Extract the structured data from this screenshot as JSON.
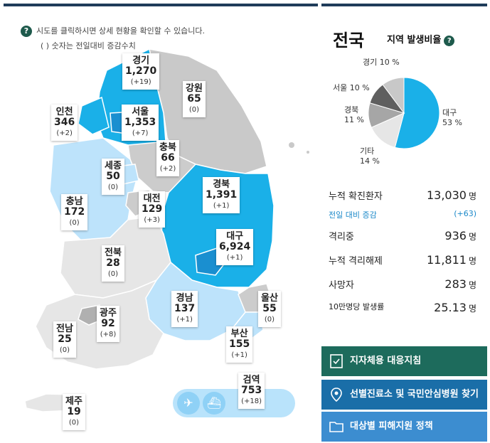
{
  "info": {
    "line1": "시도를 클릭하시면 상세 현황을 확인할 수 있습니다.",
    "line2": "( ) 숫자는 전일대비 증감수치",
    "icon": "question-icon"
  },
  "regions": [
    {
      "key": "gyeonggi",
      "name": "경기",
      "value": "1,270",
      "delta": "(+19)"
    },
    {
      "key": "gangwon",
      "name": "강원",
      "value": "65",
      "delta": "(0)"
    },
    {
      "key": "incheon",
      "name": "인천",
      "value": "346",
      "delta": "(+2)"
    },
    {
      "key": "seoul",
      "name": "서울",
      "value": "1,353",
      "delta": "(+7)"
    },
    {
      "key": "chungbuk",
      "name": "충북",
      "value": "66",
      "delta": "(+2)"
    },
    {
      "key": "sejong",
      "name": "세종",
      "value": "50",
      "delta": "(0)"
    },
    {
      "key": "gyeongbuk",
      "name": "경북",
      "value": "1,391",
      "delta": "(+1)"
    },
    {
      "key": "chungnam",
      "name": "충남",
      "value": "172",
      "delta": "(0)"
    },
    {
      "key": "daejeon",
      "name": "대전",
      "value": "129",
      "delta": "(+3)"
    },
    {
      "key": "daegu",
      "name": "대구",
      "value": "6,924",
      "delta": "(+1)"
    },
    {
      "key": "jeonbuk",
      "name": "전북",
      "value": "28",
      "delta": "(0)"
    },
    {
      "key": "gyeongnam",
      "name": "경남",
      "value": "137",
      "delta": "(+1)"
    },
    {
      "key": "ulsan",
      "name": "울산",
      "value": "55",
      "delta": "(0)"
    },
    {
      "key": "gwangju",
      "name": "광주",
      "value": "92",
      "delta": "(+8)"
    },
    {
      "key": "jeonnam",
      "name": "전남",
      "value": "25",
      "delta": "(0)"
    },
    {
      "key": "busan",
      "name": "부산",
      "value": "155",
      "delta": "(+1)"
    },
    {
      "key": "quarantine",
      "name": "검역",
      "value": "753",
      "delta": "(+18)"
    },
    {
      "key": "jeju",
      "name": "제주",
      "value": "19",
      "delta": "(0)"
    }
  ],
  "transport_icons": [
    "airplane-icon",
    "ship-icon"
  ],
  "panel": {
    "title": "전국",
    "subtitle": "지역 발생비율",
    "subtitle_icon": "question-icon"
  },
  "chart_data": {
    "type": "pie",
    "slices": [
      {
        "name": "대구",
        "value": 53,
        "label": "53 %",
        "color": "#1ab0e8"
      },
      {
        "name": "기타",
        "value": 14,
        "label": "14 %",
        "color": "#e6e6e6"
      },
      {
        "name": "경북",
        "value": 11,
        "label": "11 %",
        "color": "#a6a6a6"
      },
      {
        "name": "서울",
        "value": 10,
        "label": "10 %",
        "color": "#5f5f5f"
      },
      {
        "name": "경기",
        "value": 10,
        "label": "10 %",
        "color": "#c8c8c8"
      }
    ]
  },
  "stats": [
    {
      "label": "누적 확진환자",
      "value": "13,030",
      "unit": "명",
      "style": "main"
    },
    {
      "label": "전일 대비 증감",
      "value": "(+63)",
      "unit": "",
      "style": "small"
    },
    {
      "label": "격리중",
      "value": "936",
      "unit": "명",
      "style": "main"
    },
    {
      "label": "누적 격리해제",
      "value": "11,811",
      "unit": "명",
      "style": "main"
    },
    {
      "label": "사망자",
      "value": "283",
      "unit": "명",
      "style": "main"
    },
    {
      "label": "10만명당 발생률",
      "value": "25.13",
      "unit": "명",
      "style": "rate"
    }
  ],
  "buttons": [
    {
      "label": "지자체용 대응지침",
      "icon": "document-check-icon",
      "color": "#1d6b5c"
    },
    {
      "label": "선별진료소 및 국민안심병원 찾기",
      "icon": "map-pin-icon",
      "color": "#1a6ea8"
    },
    {
      "label": "대상별 피해지원 정책",
      "icon": "folder-icon",
      "color": "#3c8dd0"
    }
  ]
}
